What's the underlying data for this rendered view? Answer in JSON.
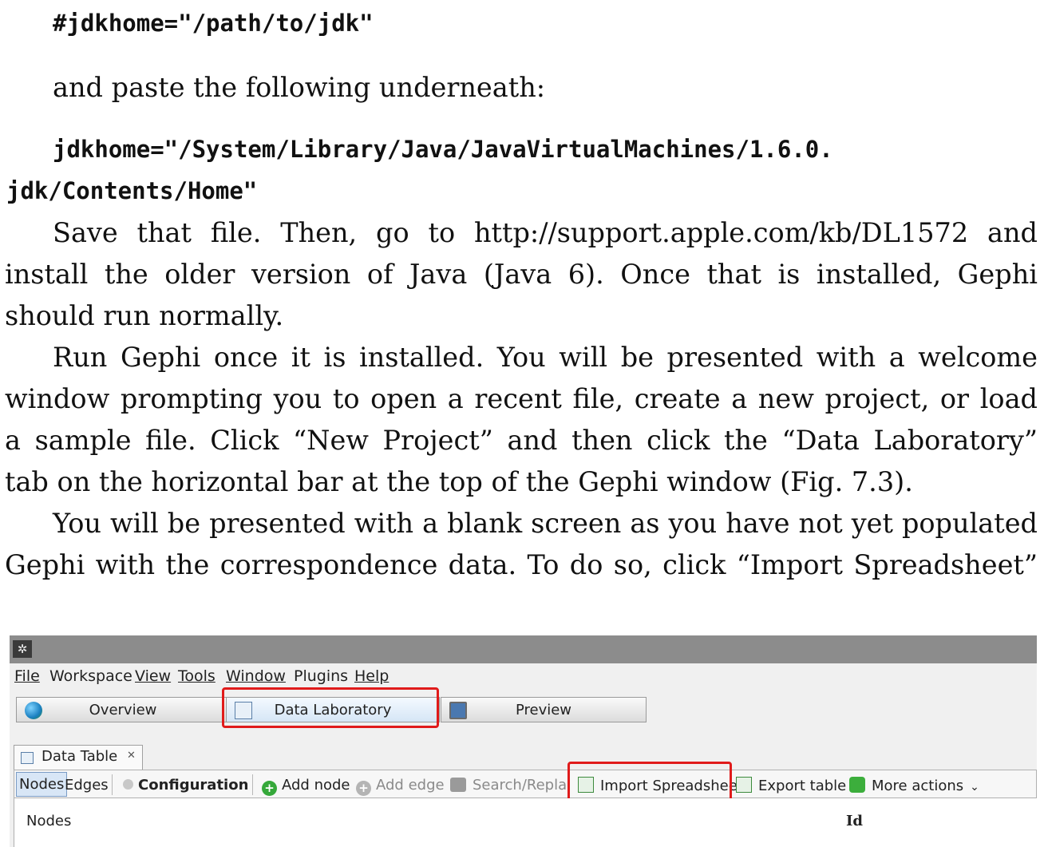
{
  "text": {
    "code_line1": "#jdkhome=\"/path/to/jdk\"",
    "line_paste": "and paste the following underneath:",
    "code_line2a": "jdkhome=\"/System/Library/Java/JavaVirtualMachines/1.6.0.",
    "code_line2b": "jdk/Contents/Home\"",
    "p1": [
      "Save that file. Then, go to http://support.apple.com/kb/DL1572 and",
      "install the older version of Java (Java 6). Once that is installed, Gephi",
      "should run normally."
    ],
    "p2": [
      "Run Gephi once it is installed. You will be presented with a welcome",
      "window prompting you to open a recent file, create a new project, or load",
      "a sample file. Click “New Project” and then click the “Data Laboratory”",
      "tab on the horizontal bar at the top of the Gephi window (Fig. 7.3)."
    ],
    "p3": [
      "You will be presented with a blank screen as you have not yet populated",
      "Gephi with the correspondence data. To do so, click “Import Spreadsheet”"
    ]
  },
  "screenshot": {
    "app_icon": "gephi-logo-icon",
    "menu": [
      "File",
      "Workspace",
      "View",
      "Tools",
      "Window",
      "Plugins",
      "Help"
    ],
    "tabs": {
      "overview": "Overview",
      "data_laboratory": "Data Laboratory",
      "preview": "Preview"
    },
    "panel_tab": "Data Table",
    "panel_close": "✕",
    "toolbar": {
      "nodes": "Nodes",
      "edges": "Edges",
      "configuration": "Configuration",
      "add_node": "Add node",
      "add_edge": "Add edge",
      "search_replace": "Search/Replace",
      "import_spreadsheet": "Import Spreadsheet",
      "export_table": "Export table",
      "more_actions": "More actions"
    },
    "table": {
      "col_nodes": "Nodes",
      "col_id": "Id"
    },
    "highlight_color": "#e01b1b"
  }
}
